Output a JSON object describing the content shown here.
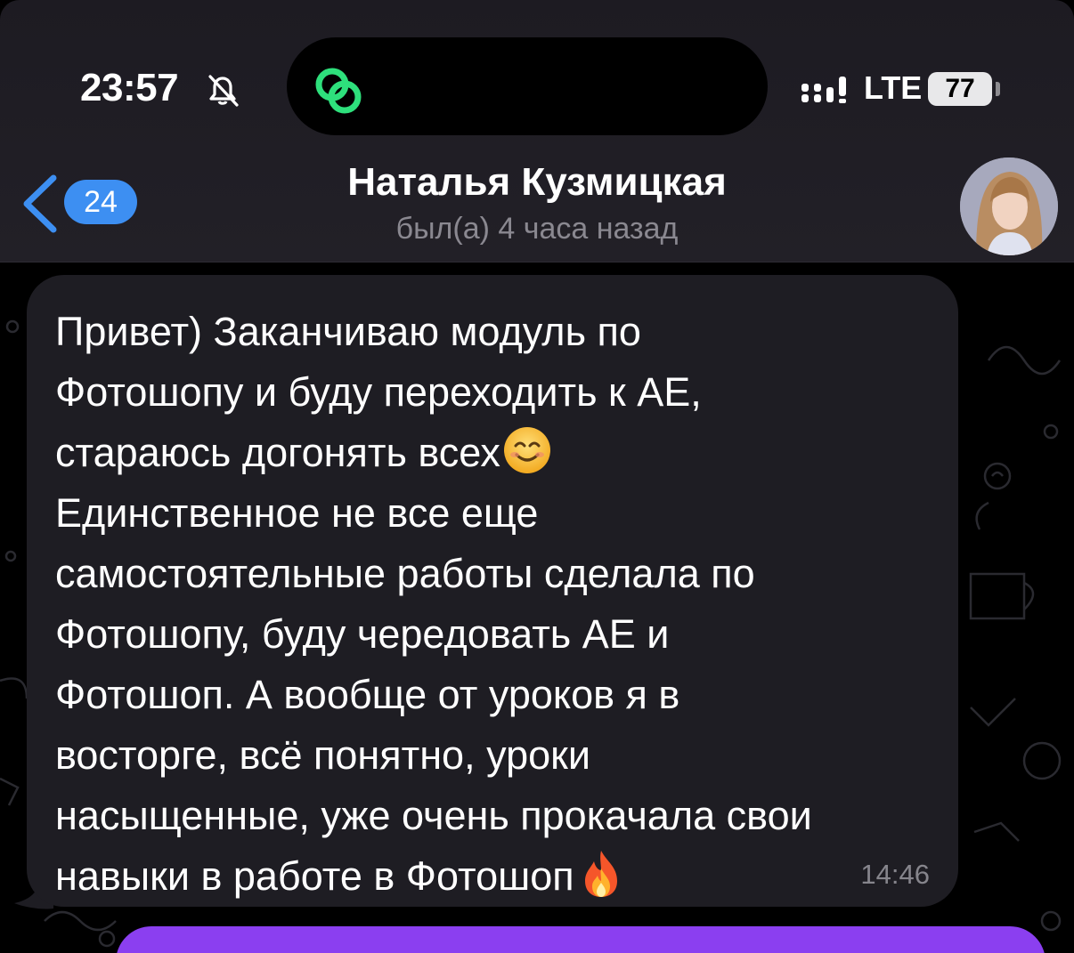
{
  "status_bar": {
    "time": "23:57",
    "network": "LTE",
    "battery": "77"
  },
  "header": {
    "back_count": "24",
    "contact_name": "Наталья Кузмицкая",
    "last_seen": "был(а) 4 часа назад"
  },
  "messages": [
    {
      "direction": "incoming",
      "line1": "Привет) Заканчиваю модуль по\nФотошопу и буду переходить к АЕ,\nстараюсь догонять всех",
      "emoji1": "smiling-face-icon",
      "line2": "\nЕдинственное не все еще\nсамостоятельные работы сделала по\nФотошопу, буду чередовать АЕ и\nФотошоп. А вообще от уроков я в\nвосторге, всё понятно, уроки\nнасыщенные, уже очень прокачала свои\nнавыки в работе в Фотошоп",
      "emoji2": "fire-icon",
      "time": "14:46"
    }
  ],
  "colors": {
    "accent": "#3d8ff2",
    "incoming_bubble": "#1e1d23",
    "outgoing_bubble": "#8b3ff0",
    "island_app": "#2ee07c"
  }
}
